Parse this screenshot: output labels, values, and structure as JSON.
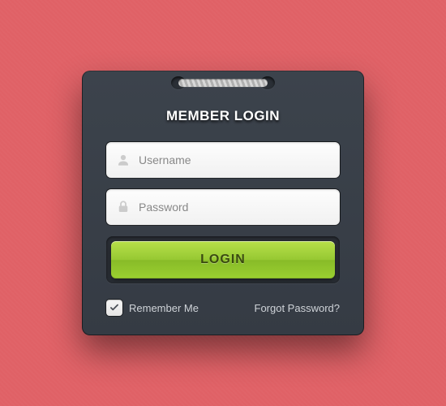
{
  "title": "MEMBER LOGIN",
  "fields": {
    "username": {
      "placeholder": "Username",
      "value": ""
    },
    "password": {
      "placeholder": "Password",
      "value": ""
    }
  },
  "login_label": "LOGIN",
  "remember": {
    "label": "Remember Me",
    "checked": true
  },
  "forgot_label": "Forgot Password?"
}
